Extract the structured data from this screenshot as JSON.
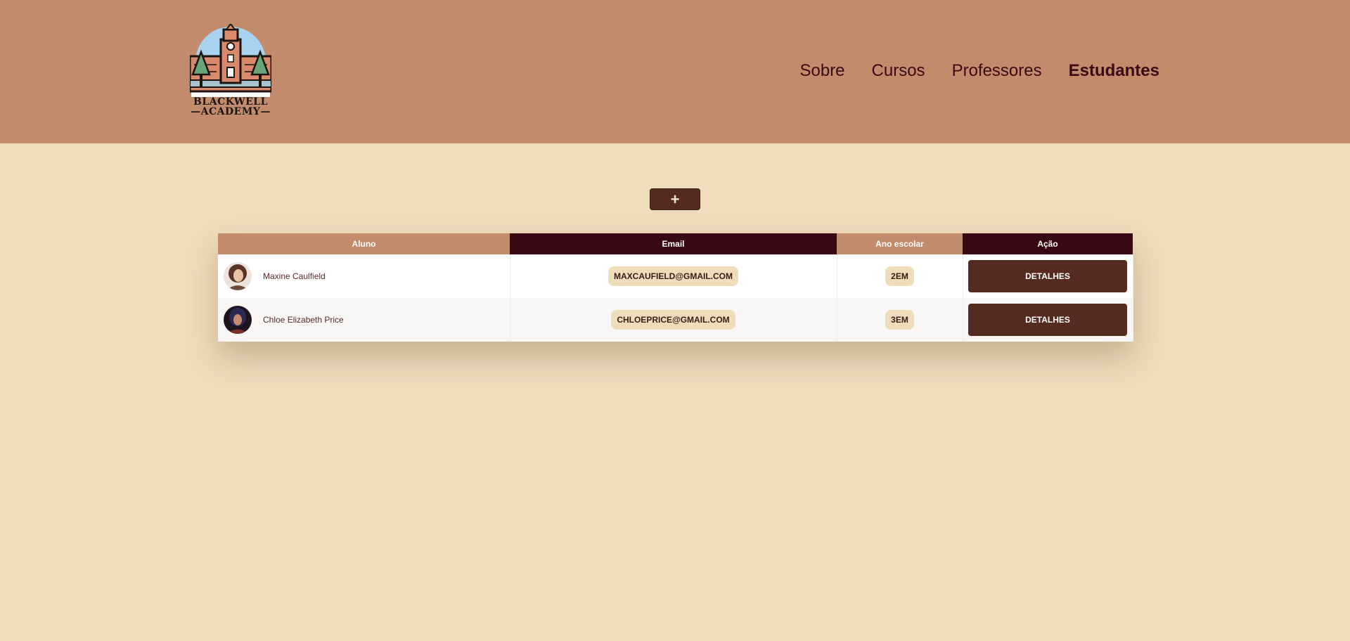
{
  "brand": {
    "line1": "BLACKWELL",
    "line2": "—ACADEMY—"
  },
  "nav": {
    "items": [
      {
        "label": "Sobre"
      },
      {
        "label": "Cursos"
      },
      {
        "label": "Professores"
      },
      {
        "label": "Estudantes",
        "active": true
      }
    ]
  },
  "toolbar": {
    "add_label": "+"
  },
  "table": {
    "headers": {
      "student": "Aluno",
      "email": "Email",
      "year": "Ano escolar",
      "action": "Ação"
    },
    "rows": [
      {
        "name": "Maxine Caulfield",
        "email": "MAXCAUFIELD@GMAIL.COM",
        "year": "2EM",
        "action": "DETALHES"
      },
      {
        "name": "Chloe Elizabeth Price",
        "email": "CHLOEPRICE@GMAIL.COM",
        "year": "3EM",
        "action": "DETALHES"
      }
    ]
  },
  "colors": {
    "header_bg": "#c28b6b",
    "page_bg": "#efdcbb",
    "dark_accent": "#380913",
    "button": "#552a20"
  }
}
